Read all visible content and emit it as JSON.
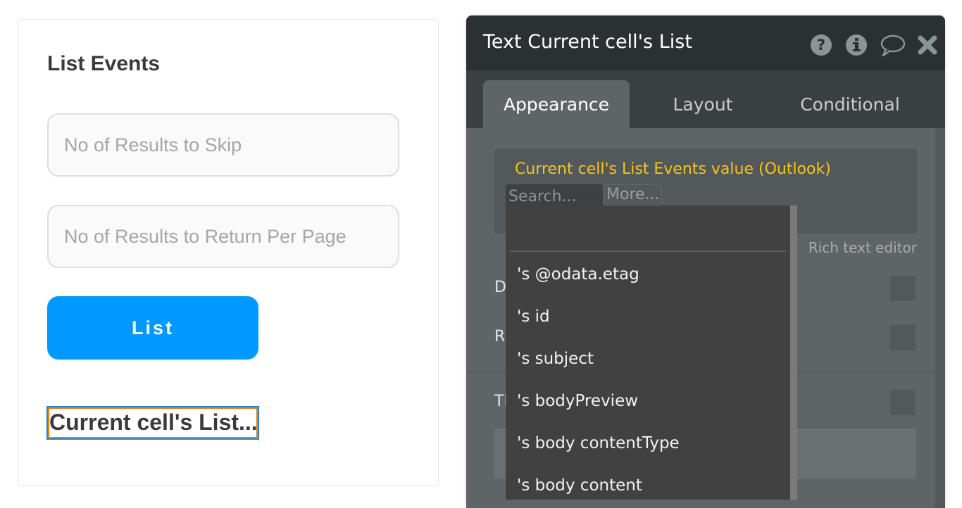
{
  "canvas": {
    "title": "List Events",
    "inputs": [
      {
        "placeholder": "No of Results to Skip",
        "value": ""
      },
      {
        "placeholder": "No of Results to Return Per Page",
        "value": ""
      }
    ],
    "button_label": "List",
    "selected_text": "Current cell's List...",
    "colors": {
      "button": "#0099ff",
      "selection_outline": "#1e88e5",
      "selection_inner": "#f07c00"
    }
  },
  "panel": {
    "title": "Text Current cell's List",
    "icons": [
      "help-icon",
      "info-icon",
      "comment-icon",
      "close-icon"
    ],
    "tabs": [
      {
        "label": "Appearance",
        "active": true
      },
      {
        "label": "Layout",
        "active": false
      },
      {
        "label": "Conditional",
        "active": false
      }
    ],
    "expression": "Current cell's List Events value (Outlook)",
    "search_placeholder": "Search...",
    "more_label": "More...",
    "rich_text_label": "Rich text editor",
    "rows": [
      {
        "label_visible": "D",
        "checked": false
      },
      {
        "label_visible": "R",
        "checked": false
      },
      {
        "label_visible": "Tl",
        "checked": false
      }
    ],
    "colors": {
      "expression": "#f5c518",
      "header_bg": "#2b3133",
      "body_bg": "#5f6467"
    }
  },
  "dropdown": {
    "filter_value": "",
    "items": [
      "'s @odata.etag",
      "'s id",
      "'s subject",
      "'s bodyPreview",
      "'s body contentType",
      "'s body content"
    ]
  }
}
